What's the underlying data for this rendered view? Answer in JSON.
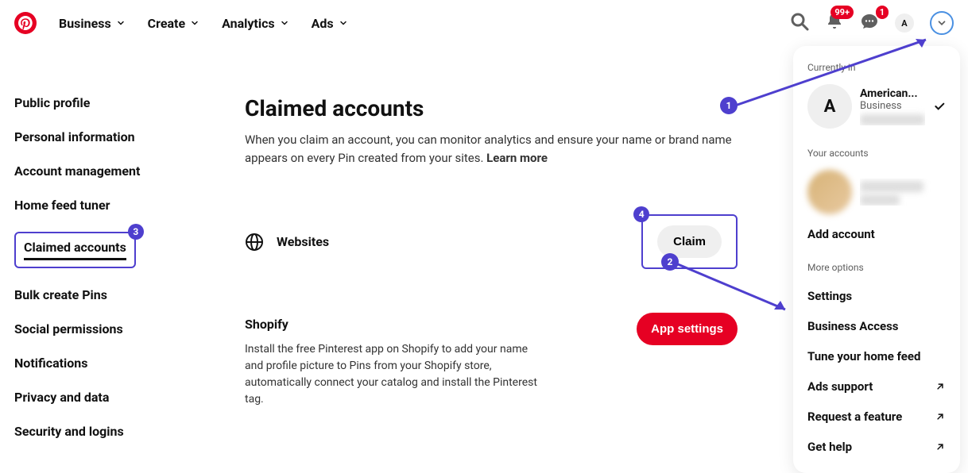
{
  "header": {
    "nav": [
      "Business",
      "Create",
      "Analytics",
      "Ads"
    ],
    "notif_badge": "99+",
    "msg_badge": "1",
    "avatar_letter": "A"
  },
  "sidebar": {
    "items": [
      "Public profile",
      "Personal information",
      "Account management",
      "Home feed tuner",
      "Claimed accounts",
      "Bulk create Pins",
      "Social permissions",
      "Notifications",
      "Privacy and data",
      "Security and logins"
    ]
  },
  "main": {
    "title": "Claimed accounts",
    "description": "When you claim an account, you can monitor analytics and ensure your name or brand name appears on every Pin created from your sites. ",
    "learn_more": "Learn more",
    "websites_label": "Websites",
    "claim_button": "Claim",
    "shopify_heading": "Shopify",
    "shopify_desc": "Install the free Pinterest app on Shopify to add your name and profile picture to Pins from your Shopify store, automatically connect your catalog and install the Pinterest tag.",
    "app_settings_button": "App settings"
  },
  "panel": {
    "currently_in": "Currently in",
    "account_name": "American...",
    "account_type": "Business",
    "your_accounts": "Your accounts",
    "add_account": "Add account",
    "more_options": "More options",
    "options": [
      {
        "label": "Settings",
        "ext": false
      },
      {
        "label": "Business Access",
        "ext": false
      },
      {
        "label": "Tune your home feed",
        "ext": false
      },
      {
        "label": "Ads support",
        "ext": true
      },
      {
        "label": "Request a feature",
        "ext": true
      },
      {
        "label": "Get help",
        "ext": true
      }
    ]
  },
  "annotations": {
    "n1": "1",
    "n2": "2",
    "n3": "3",
    "n4": "4"
  }
}
